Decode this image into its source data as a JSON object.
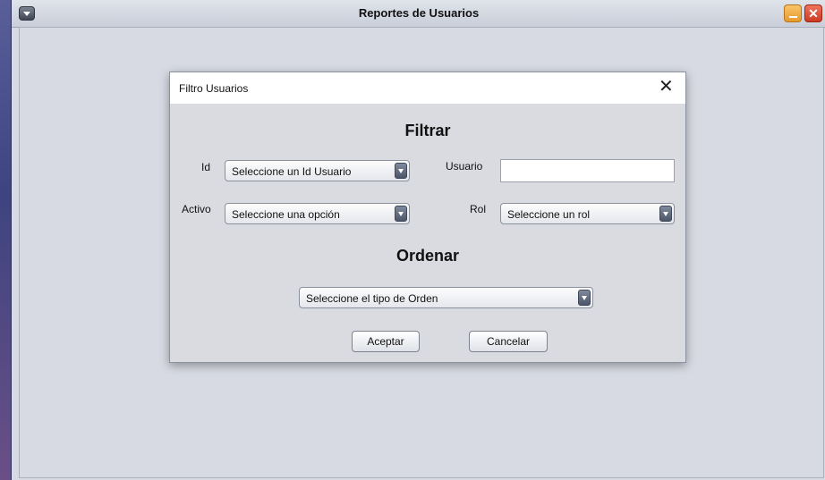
{
  "window": {
    "title": "Reportes de Usuarios",
    "icons": {
      "system_menu": "system-menu-icon",
      "minimize": "minimize-icon",
      "close": "close-icon"
    },
    "close_glyph": "✕"
  },
  "dialog": {
    "title": "Filtro Usuarios",
    "close_glyph": "✕",
    "filter_heading": "Filtrar",
    "order_heading": "Ordenar",
    "fields": {
      "id_label": "Id",
      "id_value": "Seleccione un Id Usuario",
      "usuario_label": "Usuario",
      "usuario_value": "",
      "activo_label": "Activo",
      "activo_value": "Seleccione una opción",
      "rol_label": "Rol",
      "rol_value": "Seleccione un rol",
      "orden_value": "Seleccione el tipo de Orden"
    },
    "buttons": {
      "accept": "Aceptar",
      "cancel": "Cancelar"
    }
  }
}
